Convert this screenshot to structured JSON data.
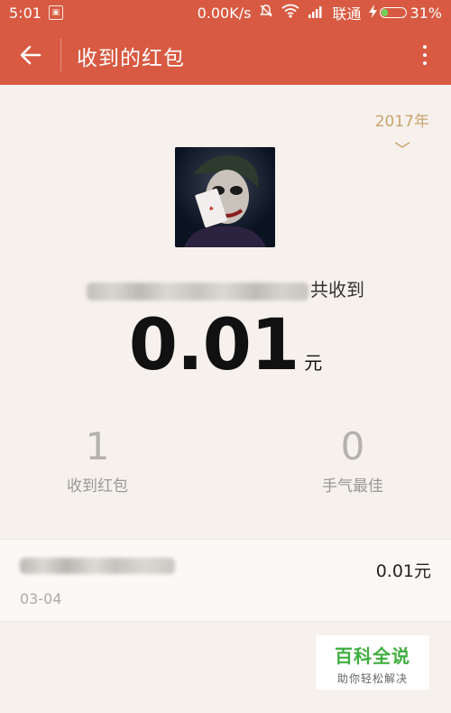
{
  "status_bar": {
    "time": "5:01",
    "speed": "0.00K/s",
    "carrier": "联通",
    "battery_percent": "31%",
    "battery_level": 0.31,
    "icons": [
      "sim-card-icon",
      "mute-icon",
      "wifi-icon",
      "signal-icon",
      "charging-icon",
      "battery-icon"
    ]
  },
  "app_bar": {
    "title": "收到的红包",
    "back_icon": "arrow-left-icon",
    "menu_icon": "more-vertical-icon"
  },
  "year_selector": {
    "year": "2017年",
    "icon": "chevron-down-icon"
  },
  "summary": {
    "sender_suffix": "共收到",
    "amount": "0.01",
    "unit": "元"
  },
  "stats": [
    {
      "value": "1",
      "label": "收到红包"
    },
    {
      "value": "0",
      "label": "手气最佳"
    }
  ],
  "records": [
    {
      "date": "03-04",
      "amount": "0.01元"
    }
  ],
  "watermark": {
    "title": "百科全说",
    "subtitle": "助你轻松解决"
  },
  "colors": {
    "brand_red": "#d85a42",
    "gold": "#c9a46e",
    "background": "#f6f1ec"
  }
}
